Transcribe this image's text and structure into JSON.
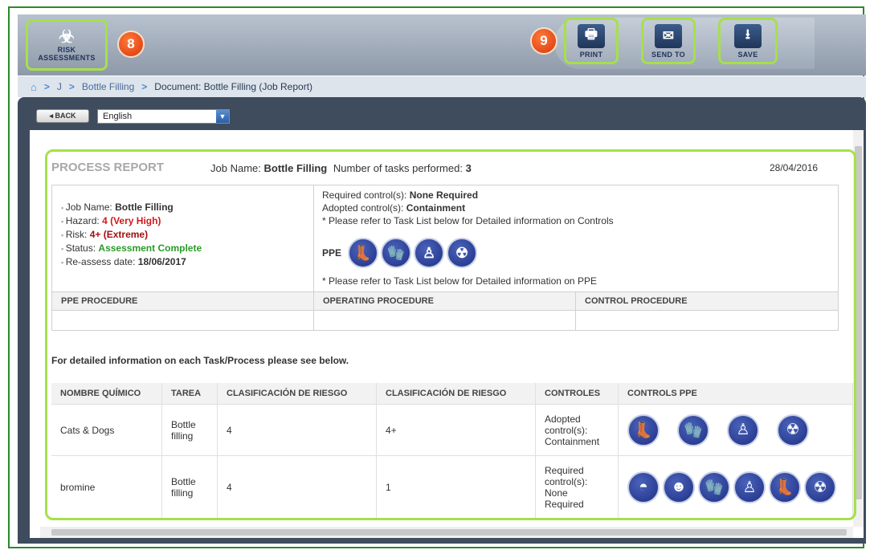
{
  "toolbar": {
    "risk_label_1": "RISK",
    "risk_label_2": "ASSESSMENTS",
    "badge_8": "8",
    "badge_9": "9",
    "print_label": "PRINT",
    "send_label": "SEND TO",
    "save_label": "SAVE"
  },
  "breadcrumb": {
    "items": [
      "J",
      "Bottle Filling",
      "Document: Bottle Filling (Job Report)"
    ],
    "separator": ">"
  },
  "controls": {
    "back_label": "◂ BACK",
    "language": "English"
  },
  "report": {
    "title": "PROCESS REPORT",
    "job_label": "Job Name:",
    "job_name": "Bottle Filling",
    "tasks_label": "Number of tasks performed:",
    "tasks_count": "3",
    "date": "28/04/2016",
    "summary": {
      "job_label": "Job Name:",
      "job": "Bottle Filling",
      "hazard_label": "Hazard:",
      "hazard": "4 (Very High)",
      "risk_label": "Risk:",
      "risk": "4+ (Extreme)",
      "status_label": "Status:",
      "status": "Assessment Complete",
      "reassess_label": "Re-assess date:",
      "reassess": "18/06/2017"
    },
    "controls_info": {
      "required_label": "Required control(s):",
      "required": "None Required",
      "adopted_label": "Adopted control(s):",
      "adopted": "Containment",
      "note_controls": "* Please refer to Task List below for Detailed information on Controls",
      "ppe_label": "PPE",
      "note_ppe": "* Please refer to Task List below for Detailed information on PPE"
    },
    "procedures": {
      "ppe": "PPE PROCEDURE",
      "operating": "OPERATING PROCEDURE",
      "control": "CONTROL PROCEDURE"
    },
    "detail_note": "For detailed information on each Task/Process please see below.",
    "task_table": {
      "headers": [
        "NOMBRE QUÍMICO",
        "TAREA",
        "CLASIFICACIÓN DE RIESGO",
        "CLASIFICACIÓN DE RIESGO",
        "CONTROLES",
        "CONTROLS PPE"
      ],
      "rows": [
        {
          "chemical": "Cats & Dogs",
          "task": "Bottle filling",
          "risk1": "4",
          "risk2": "4+",
          "controls": "Adopted control(s): Containment"
        },
        {
          "chemical": "bromine",
          "task": "Bottle filling",
          "risk1": "4",
          "risk2": "1",
          "controls": "Required control(s): None Required"
        }
      ]
    }
  },
  "colors": {
    "highlight": "#a6e04a",
    "badge": "#e0481a",
    "ppe_blue": "#2a3f9c",
    "hazard_red": "#d01a1a",
    "status_green": "#2a9a2a"
  }
}
